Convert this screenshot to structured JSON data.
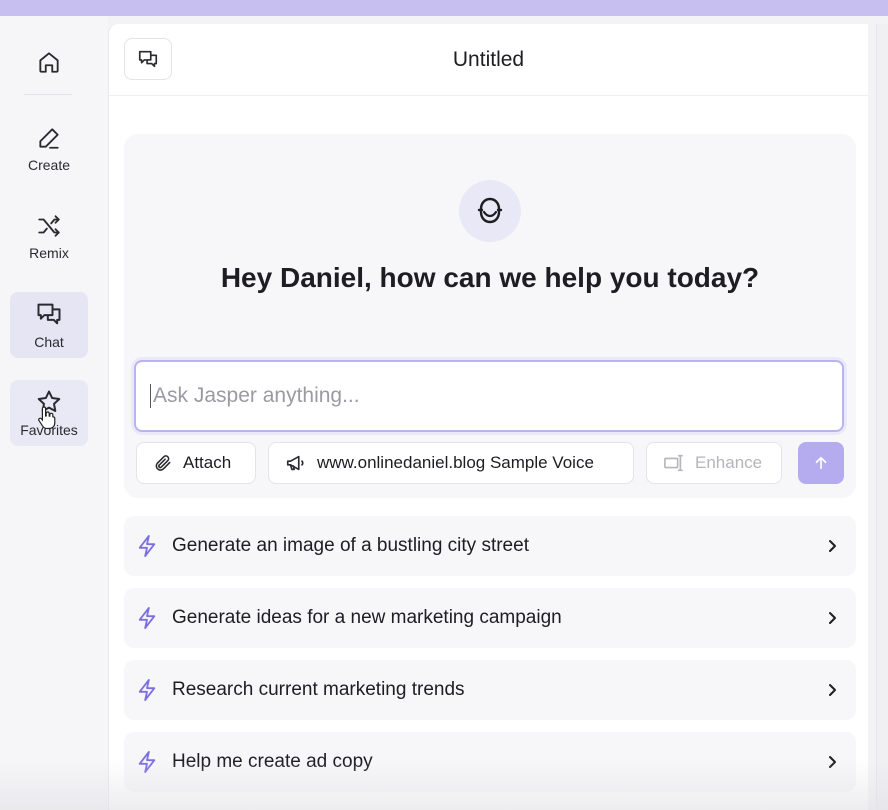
{
  "header": {
    "title": "Untitled"
  },
  "sidebar": {
    "items": [
      {
        "label": "Create",
        "icon": "pen-icon"
      },
      {
        "label": "Remix",
        "icon": "shuffle-icon"
      },
      {
        "label": "Chat",
        "icon": "chat-icon"
      },
      {
        "label": "Favorites",
        "icon": "star-icon"
      }
    ]
  },
  "hero": {
    "greeting": "Hey Daniel, how can we help you today?",
    "input_placeholder": "Ask Jasper anything...",
    "attach_label": "Attach",
    "voice_label": "www.onlinedaniel.blog Sample Voice",
    "enhance_label": "Enhance"
  },
  "suggestions": [
    {
      "text": "Generate an image of a bustling city street"
    },
    {
      "text": "Generate ideas for a new marketing campaign"
    },
    {
      "text": "Research current marketing trends"
    },
    {
      "text": "Help me create ad copy"
    }
  ],
  "colors": {
    "accent": "#7b6fe0",
    "accent_soft": "#b4acef",
    "top_bar": "#c7bff0"
  }
}
